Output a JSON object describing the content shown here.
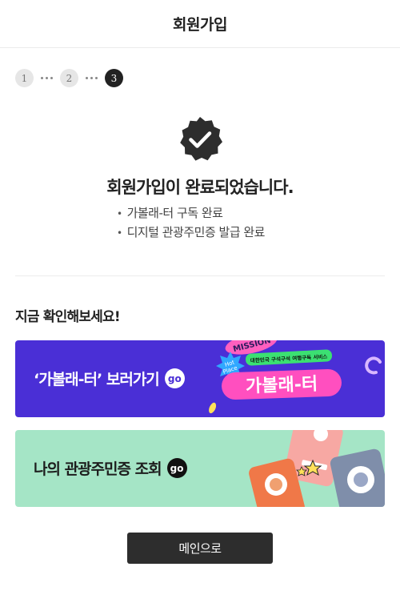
{
  "header": {
    "title": "회원가입"
  },
  "steps": [
    "1",
    "2",
    "3"
  ],
  "complete": {
    "title": "회원가입이 완료되었습니다.",
    "items": [
      "가볼래-터 구독 완료",
      "디지털 관광주민증 발급 완료"
    ]
  },
  "check_section": {
    "title": "지금 확인해보세요!"
  },
  "banners": [
    {
      "label": "‘가볼래-터’ 보러가기",
      "go": "go",
      "bg": "#4a2fd6",
      "art": {
        "mission": "MISSION",
        "hot": "Hot",
        "place": "Place",
        "tagline": "대한민국 구석구석 여행구독 서비스",
        "logo": "가볼래-터"
      }
    },
    {
      "label": "나의 관광주민증 조회",
      "go": "go",
      "bg": "#a5e5c6"
    }
  ],
  "main_button": {
    "label": "메인으로"
  },
  "colors": {
    "accent_purple": "#4a2fd6",
    "mint": "#a5e5c6",
    "dark": "#2d2d2d",
    "step_active": "#222222"
  },
  "icons": {
    "complete": "check-badge-icon"
  }
}
